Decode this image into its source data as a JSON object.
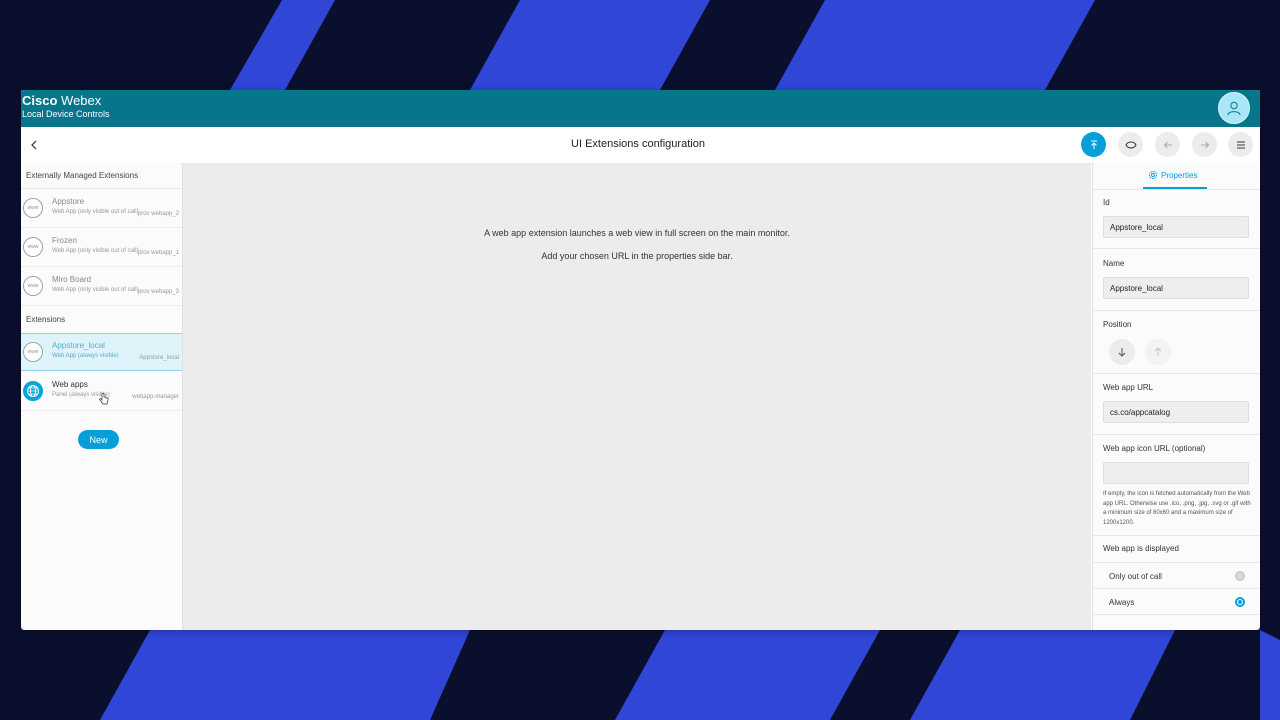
{
  "app": {
    "brand_bold": "Cisco",
    "brand_product": "Webex",
    "subtitle": "Local Device Controls"
  },
  "toolbar": {
    "title": "UI Extensions configuration"
  },
  "left": {
    "externally_managed_label": "Externally Managed Extensions",
    "extensions_label": "Extensions",
    "external_items": [
      {
        "name": "Appstore",
        "desc": "Web App (only visible out of call)",
        "id": "prov webapp_2",
        "icon_text": "www"
      },
      {
        "name": "Frozen",
        "desc": "Web App (only visible out of call)",
        "id": "prov webapp_1",
        "icon_text": "www"
      },
      {
        "name": "Miro Board",
        "desc": "Web App (only visible out of call)",
        "id": "prov webapp_3",
        "icon_text": "www"
      }
    ],
    "local_items": [
      {
        "name": "Appstore_local",
        "desc": "Web App (always visible)",
        "id": "Appstore_local",
        "icon_text": "www"
      },
      {
        "name": "Web apps",
        "desc": "Panel (always visible)",
        "id": "webapp-manager"
      }
    ],
    "new_button": "New"
  },
  "center": {
    "line1": "A web app extension launches a web view in full screen on the main monitor.",
    "line2": "Add your chosen URL in the properties side bar."
  },
  "properties": {
    "tab_label": "Properties",
    "id_label": "Id",
    "id_value": "Appstore_local",
    "name_label": "Name",
    "name_value": "Appstore_local",
    "position_label": "Position",
    "url_label": "Web app URL",
    "url_value": "cs.co/appcatalog",
    "icon_url_label": "Web app icon URL (optional)",
    "icon_url_value": "",
    "help_text": "If empty, the icon is fetched automatically from the Web app URL. Otherwise use .ico, .png, .jpg, .svg or .gif with a minimum size of 60x60 and a maximum size of 1200x1200.",
    "display_label": "Web app is displayed",
    "option_out_of_call": "Only out of call",
    "option_always": "Always",
    "selected_option": "Always"
  },
  "colors": {
    "titlebar": "#07758a",
    "accent": "#049fd9",
    "background": "#2f46d6",
    "stripe": "#0b0f2e"
  }
}
